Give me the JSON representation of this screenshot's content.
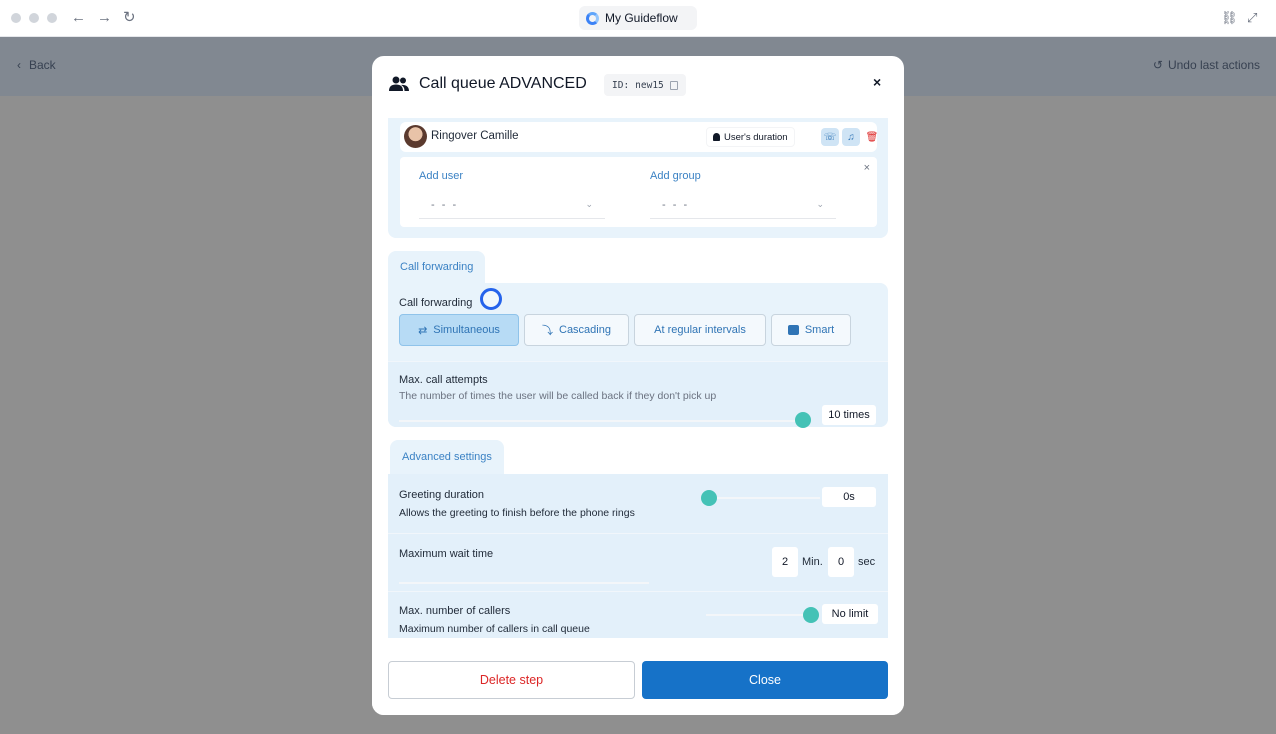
{
  "browser": {
    "tab_title": "My Guideflow"
  },
  "app": {
    "back_label": "Back",
    "undo_label": "Undo last actions"
  },
  "modal": {
    "title": "Call queue ADVANCED",
    "id_label": "ID:",
    "id_value": "new15",
    "close_glyph": "×"
  },
  "user": {
    "name": "Ringover Camille",
    "duration_chip": "User's duration"
  },
  "add": {
    "user_label": "Add user",
    "group_label": "Add group",
    "user_placeholder": "- - -",
    "group_placeholder": "- - -",
    "dismiss_glyph": "×"
  },
  "forwarding": {
    "tab": "Call forwarding",
    "label": "Call forwarding",
    "modes": [
      "Simultaneous",
      "Cascading",
      "At regular intervals",
      "Smart"
    ],
    "active_mode": "Simultaneous",
    "max_attempts_label": "Max. call attempts",
    "max_attempts_desc": "The number of times the user will be called back if they don't pick up",
    "max_attempts_value": "10 times"
  },
  "advanced": {
    "tab": "Advanced settings",
    "greeting_label": "Greeting duration",
    "greeting_desc": "Allows the greeting to finish before the phone rings",
    "greeting_value": "0s",
    "wait_label": "Maximum wait time",
    "wait_min": "2",
    "wait_min_unit": "Min.",
    "wait_sec": "0",
    "wait_sec_unit": "sec",
    "callers_label": "Max. number of callers",
    "callers_desc": "Maximum number of callers in call queue",
    "callers_value": "No limit"
  },
  "footer": {
    "delete_label": "Delete step",
    "close_label": "Close"
  },
  "colors": {
    "primary": "#1672c8",
    "danger": "#dc2626",
    "teal": "#44c2b6",
    "panel": "#e8f3fb"
  }
}
